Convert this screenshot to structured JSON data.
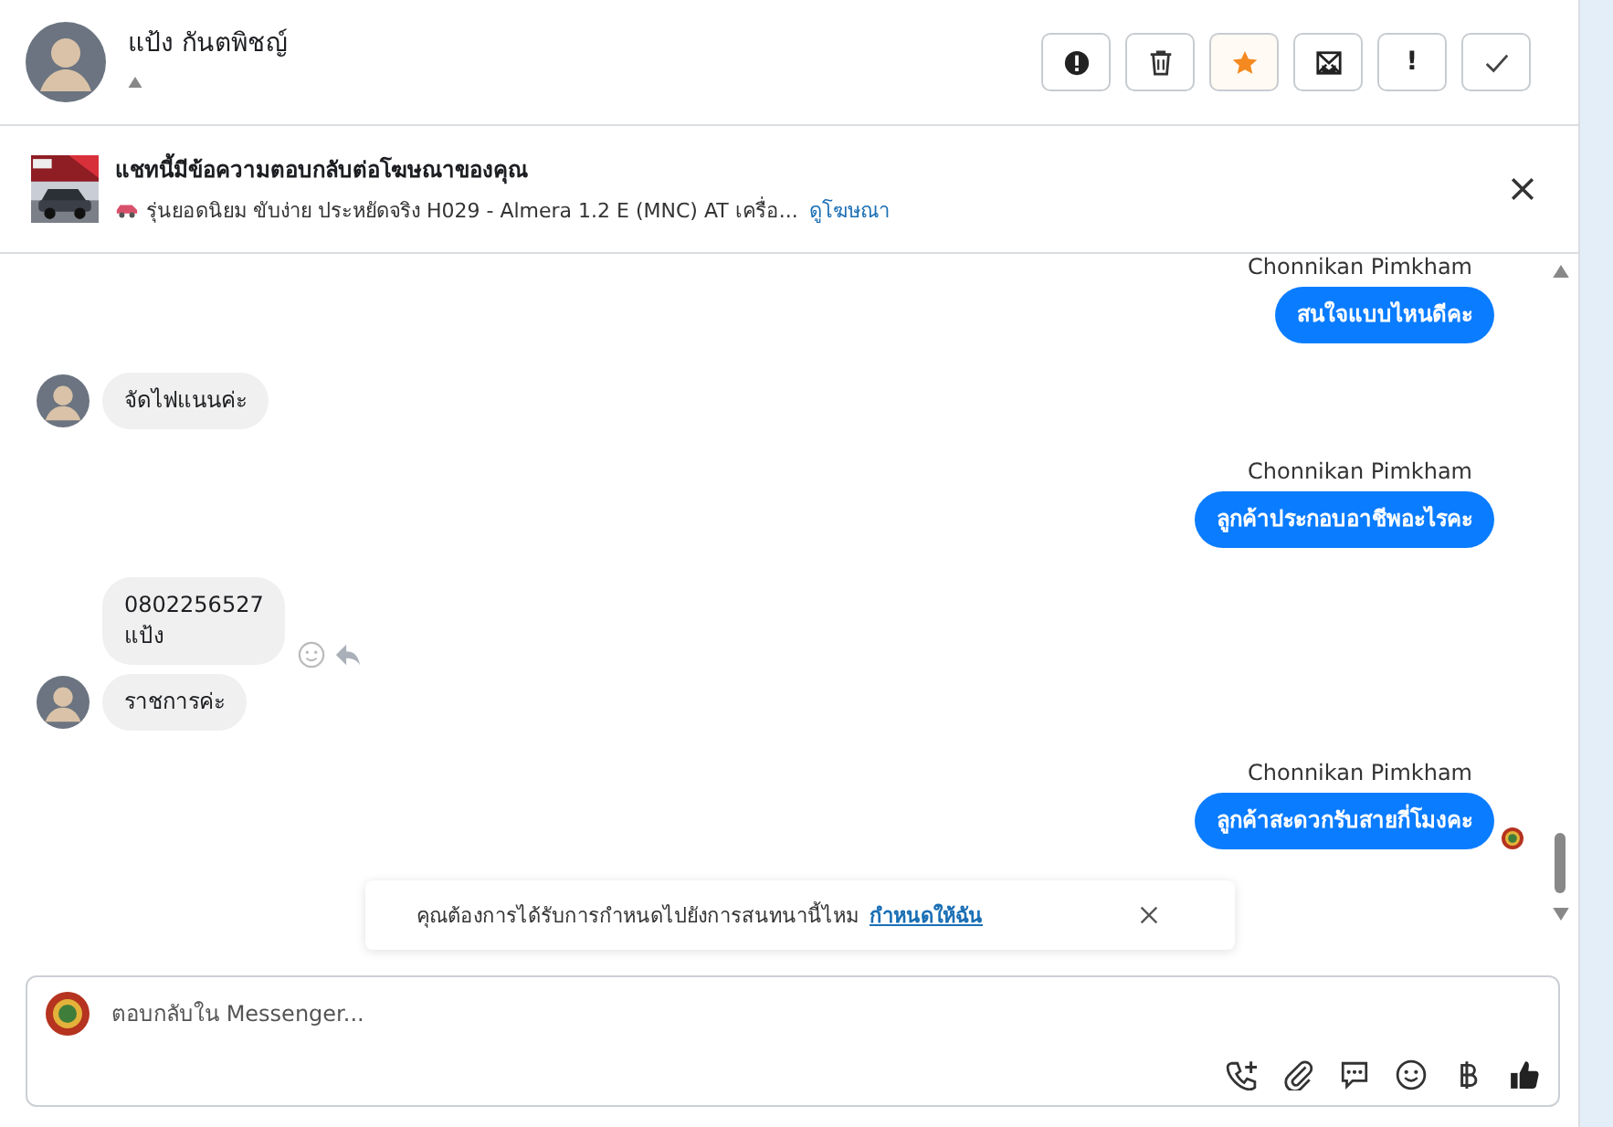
{
  "contact": {
    "name": "แป้ง กันตพิชญ์"
  },
  "actions": [
    {
      "kind": "alert",
      "on": false
    },
    {
      "kind": "delete",
      "on": false
    },
    {
      "kind": "star",
      "on": true
    },
    {
      "kind": "mail",
      "on": false
    },
    {
      "kind": "important",
      "label": "!",
      "on": false
    },
    {
      "kind": "done",
      "on": false
    }
  ],
  "ad_banner": {
    "title": "แชทนี้มีข้อความตอบกลับต่อโฆษณาของคุณ",
    "description": "รุ่นยอดนิยม ขับง่าย ประหยัดจริง H029 - Almera 1.2 E (MNC) AT เครื่อ...",
    "link": "ดูโฆษณา"
  },
  "messages": [
    {
      "kind": "outgoing",
      "sender": "Chonnikan Pimkham",
      "text": "สนใจแบบไหนดีคะ",
      "seen": false
    },
    {
      "kind": "incoming",
      "text": "จัดไฟแนนค่ะ",
      "avatar": true,
      "actions_visible": false
    },
    {
      "kind": "outgoing",
      "sender": "Chonnikan Pimkham",
      "text": "ลูกค้าประกอบอาชีพอะไรคะ",
      "seen": false
    },
    {
      "kind": "incoming",
      "text": "0802256527\nแป้ง",
      "avatar": false,
      "actions_visible": true
    },
    {
      "kind": "incoming",
      "text": "ราชการค่ะ",
      "avatar": true,
      "actions_visible": false
    },
    {
      "kind": "outgoing",
      "sender": "Chonnikan Pimkham",
      "text": "ลูกค้าสะดวกรับสายกี่โมงคะ",
      "seen": true
    }
  ],
  "toast": {
    "text": "คุณต้องการได้รับการกำหนดไปยังการสนทนานี้ไหม",
    "link": "กำหนดให้ฉัน"
  },
  "composer": {
    "placeholder": "ตอบกลับใน Messenger...",
    "tools": [
      {
        "kind": "call"
      },
      {
        "kind": "attach"
      },
      {
        "kind": "saved-reply"
      },
      {
        "kind": "emoji"
      },
      {
        "kind": "baht"
      },
      {
        "kind": "like"
      }
    ]
  }
}
